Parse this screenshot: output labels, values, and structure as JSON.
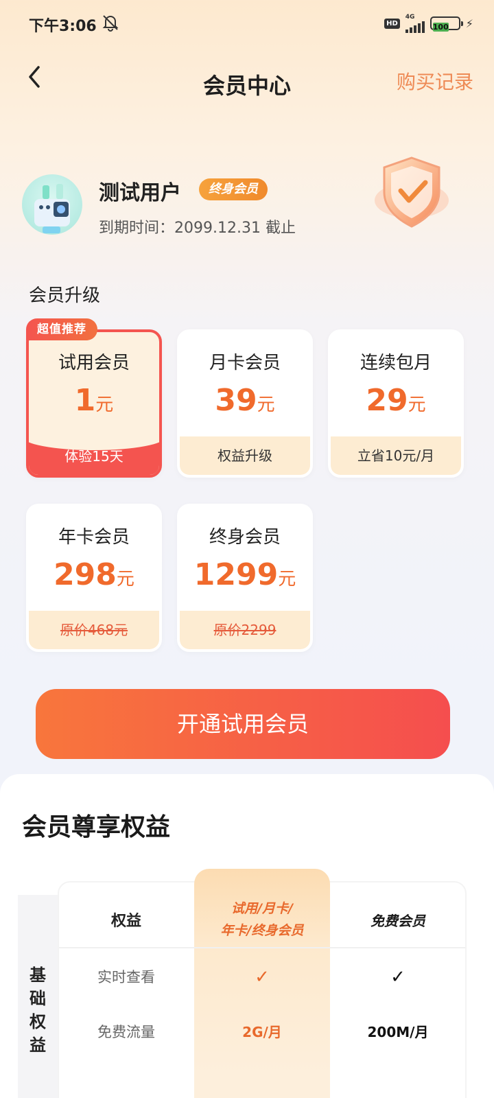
{
  "status_bar": {
    "time": "下午3:06",
    "hd": "HD",
    "network": "4G",
    "battery": "100"
  },
  "header": {
    "title": "会员中心",
    "purchase_records": "购买记录"
  },
  "user": {
    "name": "测试用户",
    "badge": "终身会员",
    "expire_label": "到期时间：",
    "expire_value": "2099.12.31 截止"
  },
  "upgrade_section": {
    "title": "会员升级",
    "recommend_tag": "超值推荐"
  },
  "plans": [
    {
      "name": "试用会员",
      "price": "1",
      "unit": "元",
      "footer": "体验15天",
      "selected": true
    },
    {
      "name": "月卡会员",
      "price": "39",
      "unit": "元",
      "footer": "权益升级"
    },
    {
      "name": "连续包月",
      "price": "29",
      "unit": "元",
      "footer": "立省10元/月"
    },
    {
      "name": "年卡会员",
      "price": "298",
      "unit": "元",
      "footer": "原价468元",
      "strike": true
    },
    {
      "name": "终身会员",
      "price": "1299",
      "unit": "元",
      "footer": "原价2299",
      "strike": true
    }
  ],
  "cta": {
    "label": "开通试用会员"
  },
  "benefits": {
    "title": "会员尊享权益",
    "category": "基础权益",
    "category_chars": [
      "基",
      "础",
      "权",
      "益"
    ],
    "headers": {
      "benefit": "权益",
      "vip_line1": "试用/月卡/",
      "vip_line2": "年卡/终身会员",
      "free": "免费会员"
    },
    "rows": [
      {
        "name": "实时查看",
        "vip": "✓",
        "free": "✓"
      },
      {
        "name": "免费流量",
        "vip": "2G/月",
        "free": "200M/月"
      }
    ]
  },
  "colors": {
    "accent": "#f06a2c",
    "selected_border": "#f4544f",
    "cta_start": "#f8763c",
    "cta_end": "#f54e4e"
  }
}
